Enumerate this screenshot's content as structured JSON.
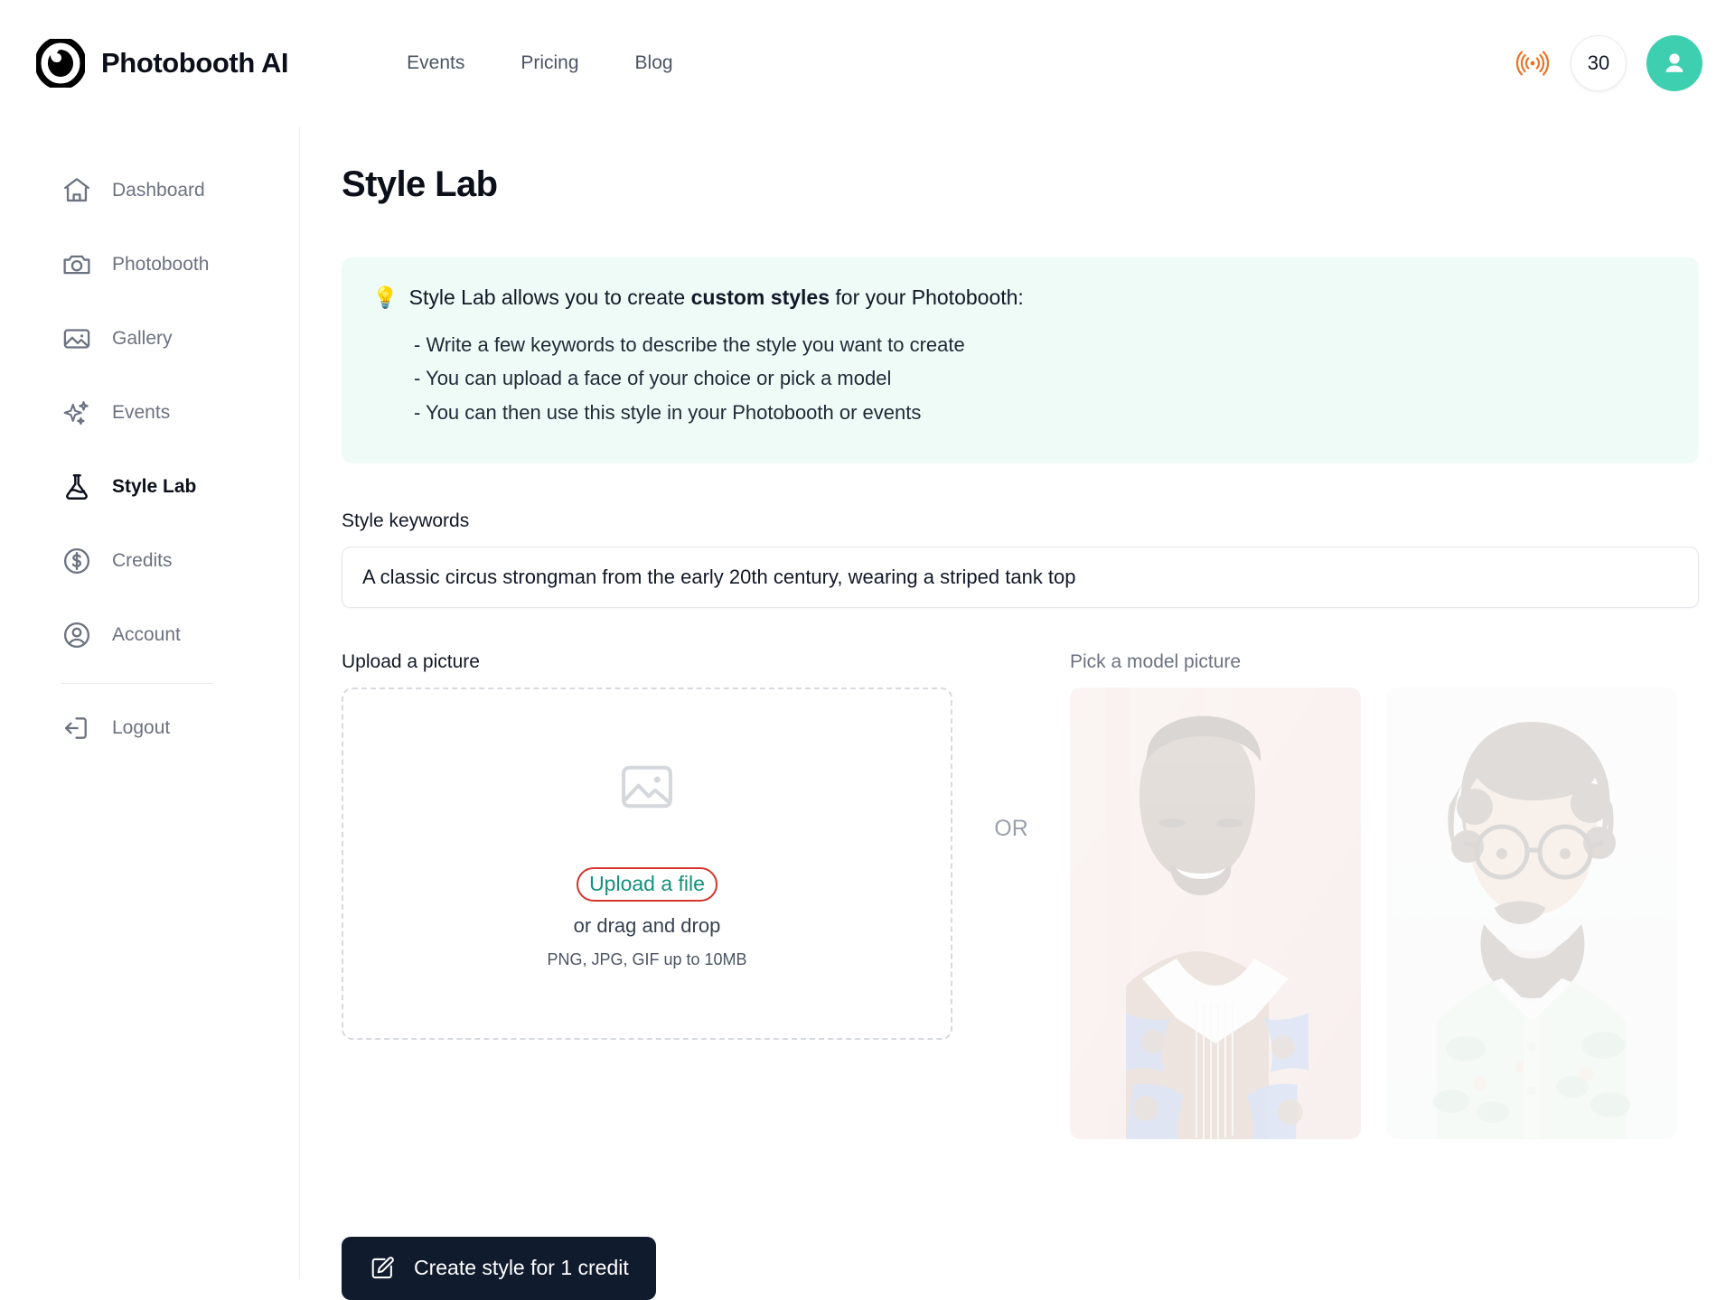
{
  "header": {
    "brand_name": "Photobooth AI",
    "logo_icon": "aperture-logo-icon",
    "nav": [
      {
        "label": "Events"
      },
      {
        "label": "Pricing"
      },
      {
        "label": "Blog"
      }
    ],
    "broadcast_icon": "broadcast-live-icon",
    "credits_count": "30",
    "avatar_icon": "user-avatar-icon"
  },
  "sidebar": {
    "items": [
      {
        "label": "Dashboard",
        "icon": "home-icon",
        "active": false
      },
      {
        "label": "Photobooth",
        "icon": "camera-icon",
        "active": false
      },
      {
        "label": "Gallery",
        "icon": "image-icon",
        "active": false
      },
      {
        "label": "Events",
        "icon": "sparkles-icon",
        "active": false
      },
      {
        "label": "Style Lab",
        "icon": "flask-icon",
        "active": true
      },
      {
        "label": "Credits",
        "icon": "dollar-circle-icon",
        "active": false
      },
      {
        "label": "Account",
        "icon": "user-circle-icon",
        "active": false
      },
      {
        "label": "Logout",
        "icon": "logout-icon",
        "active": false
      }
    ]
  },
  "main": {
    "page_title": "Style Lab",
    "banner": {
      "bulb_icon": "💡",
      "intro_before": "Style Lab allows you to create ",
      "intro_bold": "custom styles",
      "intro_after": " for your Photobooth:",
      "bullets": [
        "- Write a few keywords to describe the style you want to create",
        "- You can upload a face of your choice or pick a model",
        "- You can then use this style in your Photobooth or events"
      ]
    },
    "keywords": {
      "label": "Style keywords",
      "value": "A classic circus strongman from the early 20th century, wearing a striped tank top",
      "placeholder": "Style keywords"
    },
    "upload": {
      "label": "Upload a picture",
      "image_icon": "image-placeholder-icon",
      "link_label": "Upload a file",
      "drag_text": "or drag and drop",
      "formats_hint": "PNG, JPG, GIF up to 10MB",
      "highlight_color": "#d6342c",
      "link_color": "#12917c"
    },
    "or_separator": "OR",
    "models": {
      "label": "Pick a model picture",
      "items": [
        {
          "alt": "Smiling woman with short hair, white collar shirt, pink background"
        },
        {
          "alt": "Bearded man with curly hair and round glasses, green patterned shirt"
        }
      ]
    },
    "create_button": {
      "label": "Create style for 1 credit",
      "icon": "pencil-square-icon",
      "background": "#111b2e"
    }
  }
}
